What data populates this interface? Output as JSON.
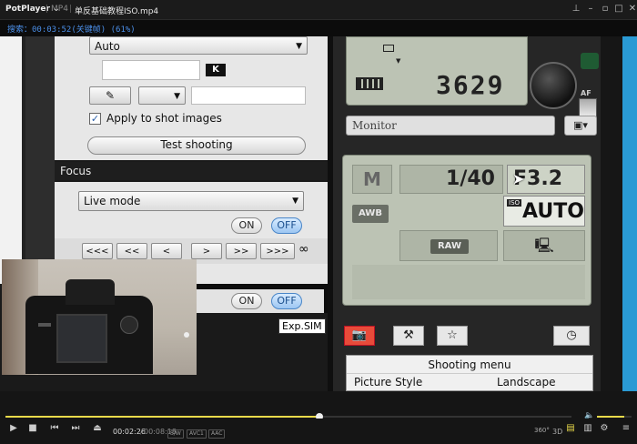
{
  "titlebar": {
    "app_name": "PotPlayer",
    "menu_arrow": "⌄",
    "separator": "|",
    "format": "MP4",
    "file_name": "单反基础教程ISO.mp4",
    "icons": [
      "pin-icon",
      "minimize-icon",
      "restore-icon",
      "maximize-icon",
      "close-icon"
    ]
  },
  "osd": {
    "text": "搜索：00:03:52(关键帧) (61%)"
  },
  "left_panel": {
    "mode_select": "Auto",
    "k_badge": "K",
    "apply_checkbox_label": "Apply to shot images",
    "apply_checked": true,
    "test_button": "Test shooting",
    "focus_section": "Focus",
    "focus_select": "Live mode",
    "toggle1_on": "ON",
    "toggle1_off": "OFF",
    "af_buttons": [
      "<",
      "<<",
      "<<<",
      ">",
      ">>",
      ">>>"
    ],
    "infinity": "∞",
    "toggle2_on": "ON",
    "toggle2_off": "OFF",
    "tooltip": "Exp.SIM"
  },
  "camera_panel": {
    "shot_count": "3629",
    "af_label": "AF",
    "mf_label": "MF",
    "monitor_field": "Monitor",
    "mode": "M",
    "shutter": "1/40",
    "aperture": "F3.2",
    "wb": "AWB",
    "iso_label": "ISO",
    "iso_value": "AUTO",
    "quality": "RAW",
    "menu_title": "Shooting menu",
    "menu_row_label": "Picture Style",
    "menu_row_value": "Landscape"
  },
  "controls": {
    "elapsed": "00:02:26",
    "duration": "00:08:18",
    "badges": [
      "S/W",
      "AVC1",
      "AAC"
    ],
    "right_labels": [
      "360°",
      "3D"
    ],
    "progress_fraction": 0.555,
    "volume_fraction": 0.8,
    "accent": "#e8d94a"
  }
}
